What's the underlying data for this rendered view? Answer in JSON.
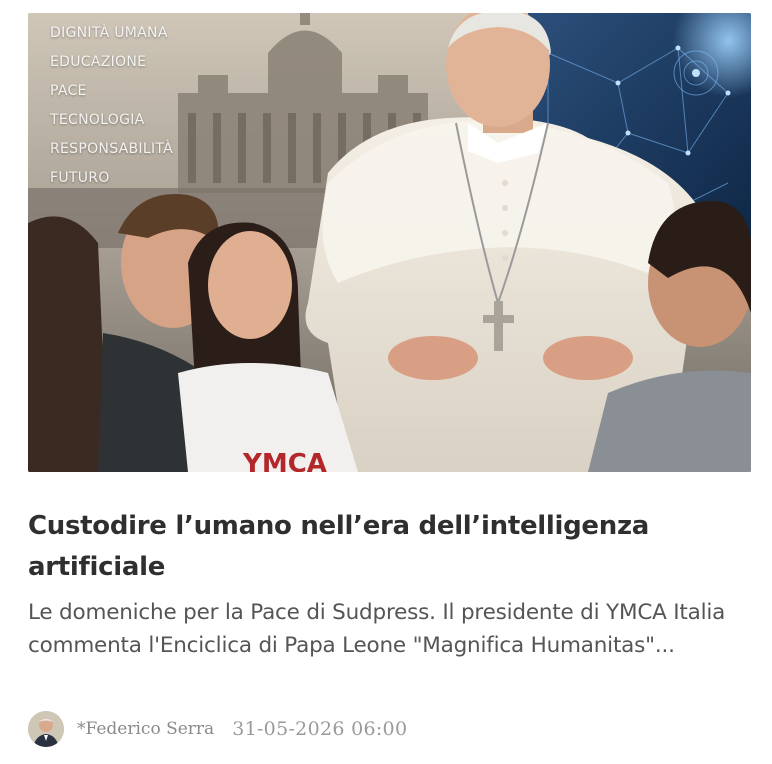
{
  "article": {
    "keywords": [
      "DIGNITÀ UMANA",
      "EDUCAZIONE",
      "PACE",
      "TECNOLOGIA",
      "RESPONSABILITÀ",
      "FUTURO"
    ],
    "hero_shirt_text": "YMCA",
    "title": "Custodire l’umano nell’era dell’intelligenza artificiale",
    "excerpt": "Le domeniche per la Pace di Sudpress. Il presidente di YMCA Italia commenta l'Enciclica di Papa Leone \"Magnifica Humanitas\"...",
    "author": "*Federico Serra",
    "date": "31-05-2026 06:00"
  },
  "colors": {
    "title": "#2f2f2f",
    "excerpt": "#555555",
    "meta": "#8a8a8a",
    "shirt_text": "#b3262a"
  }
}
